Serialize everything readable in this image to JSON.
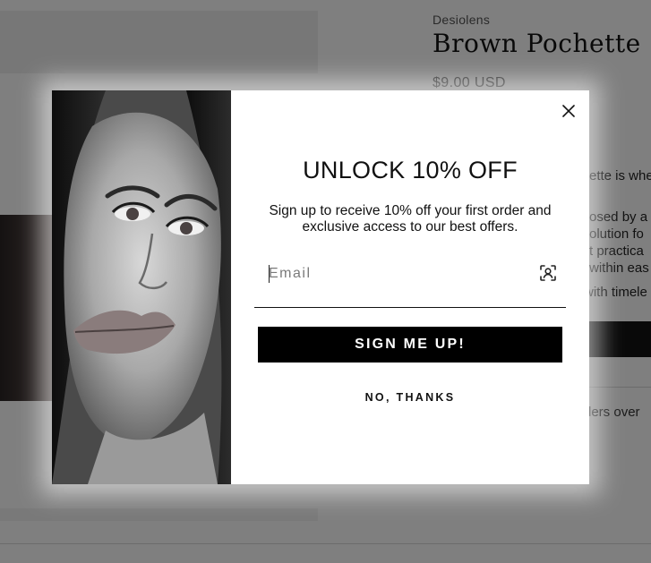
{
  "product": {
    "vendor": "Desiolens",
    "title": "Brown Pochette",
    "price": "$9.00 USD",
    "description_fragments": [
      "ette is whe",
      "osed by a",
      "olution fo",
      "t practica",
      "within eas",
      "with timele"
    ],
    "shipping_fragment": "ders over"
  },
  "popup": {
    "headline": "UNLOCK 10% OFF",
    "subtext": "Sign up to receive 10% off your first order and exclusive access to our best offers.",
    "email_placeholder": "Email",
    "email_value": "",
    "submit_label": "SIGN ME UP!",
    "decline_label": "NO, THANKS",
    "close_icon": "close-icon",
    "autofill_icon": "contact-autofill-icon"
  },
  "colors": {
    "overlay": "rgba(0,0,0,0.5)",
    "button": "#000000",
    "button_text": "#ffffff"
  }
}
